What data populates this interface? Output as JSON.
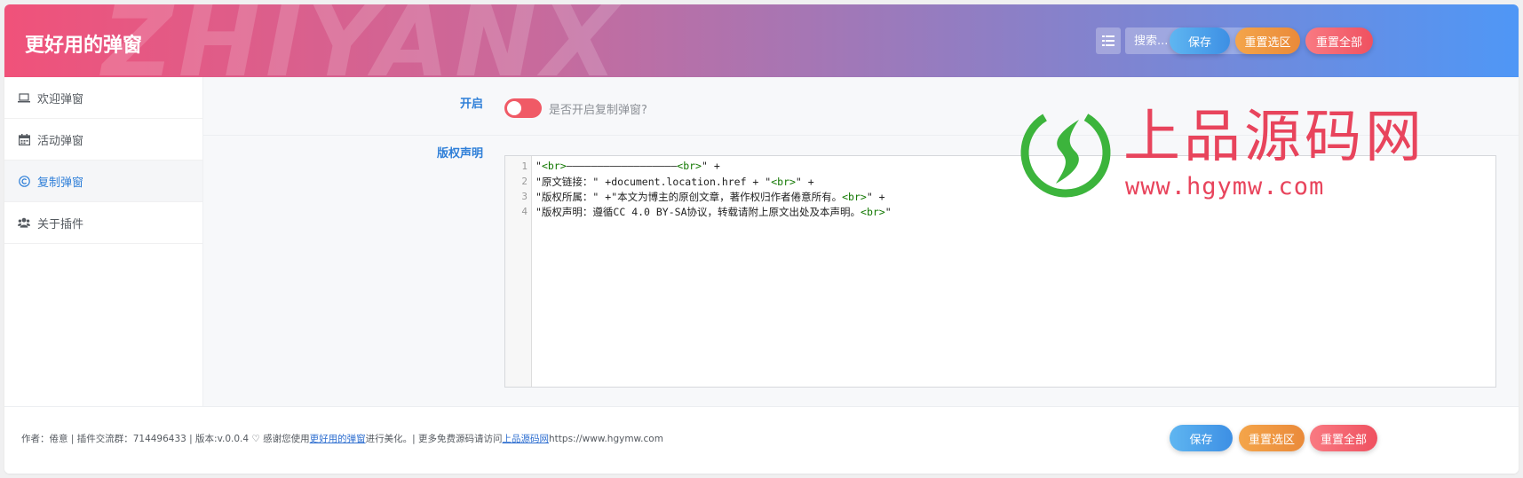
{
  "header": {
    "title": "更好用的弹窗",
    "watermark": "ZHIYANX",
    "search_placeholder": "搜索...",
    "buttons": {
      "save": "保存",
      "reset_section": "重置选区",
      "reset_all": "重置全部"
    }
  },
  "sidebar": {
    "items": [
      {
        "label": "欢迎弹窗",
        "icon": "laptop-icon"
      },
      {
        "label": "活动弹窗",
        "icon": "calendar-icon"
      },
      {
        "label": "复制弹窗",
        "icon": "copyright-icon",
        "active": true
      },
      {
        "label": "关于插件",
        "icon": "users-icon"
      }
    ]
  },
  "main": {
    "toggle_field": {
      "label": "开启",
      "description": "是否开启复制弹窗?",
      "enabled": false
    },
    "copyright_field": {
      "label": "版权声明",
      "lines": [
        {
          "num": "1",
          "parts": [
            [
              "t",
              "\""
            ],
            [
              "g",
              "<br>"
            ],
            [
              "t",
              "——————————————————"
            ],
            [
              "g",
              "<br>"
            ],
            [
              "t",
              "\" +"
            ]
          ]
        },
        {
          "num": "2",
          "parts": [
            [
              "t",
              "\"原文链接：\" +document.location.href + \""
            ],
            [
              "g",
              "<br>"
            ],
            [
              "t",
              "\" +"
            ]
          ]
        },
        {
          "num": "3",
          "parts": [
            [
              "t",
              "\"版权所属：\" +\"本文为博主的原创文章，著作权归作者倦意所有。"
            ],
            [
              "g",
              "<br>"
            ],
            [
              "t",
              "\" +"
            ]
          ]
        },
        {
          "num": "4",
          "parts": [
            [
              "t",
              "\"版权声明：遵循CC 4.0 BY-SA协议，转载请附上原文出处及本声明。"
            ],
            [
              "g",
              "<br>"
            ],
            [
              "t",
              "\""
            ]
          ]
        }
      ]
    }
  },
  "watermark_logo": {
    "name": "上品源码网",
    "url": "www.hgymw.com"
  },
  "footer": {
    "text_before_link1": "作者：倦意 | 插件交流群：714496433 | 版本:v.0.0.4 ♡ 感谢您使用",
    "link1": "更好用的弹窗",
    "text_after_link1": "进行美化。| 更多免费源码请访问",
    "link2": "上品源码网",
    "text_after_link2": "https://www.hgymw.com",
    "buttons": {
      "save": "保存",
      "reset_section": "重置选区",
      "reset_all": "重置全部"
    }
  },
  "colors": {
    "accent": "#2f7fd8",
    "toggle_off": "#f05a66",
    "logo_red": "#e8445c",
    "logo_green": "#3cb43c"
  }
}
